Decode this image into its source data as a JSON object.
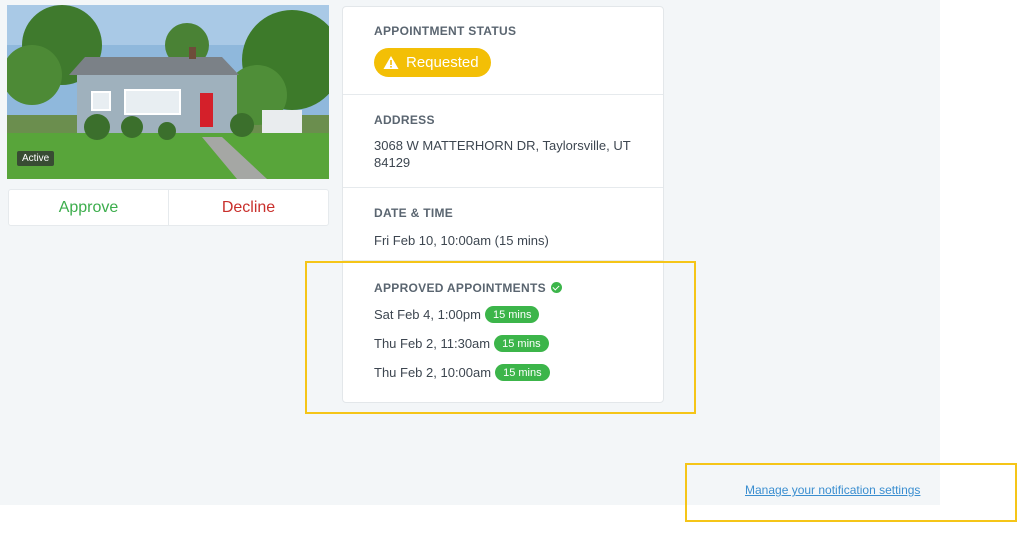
{
  "listing": {
    "status_tag": "Active",
    "approve_label": "Approve",
    "decline_label": "Decline"
  },
  "appointment_status": {
    "label": "APPOINTMENT STATUS",
    "value": "Requested",
    "icon": "warning-triangle-icon",
    "color": "#f3bf06"
  },
  "address": {
    "label": "ADDRESS",
    "line1": "3068 W MATTERHORN DR, Taylorsville, UT",
    "line2": "84129"
  },
  "date_time": {
    "label": "DATE & TIME",
    "value": "Fri Feb 10, 10:00am (15 mins)"
  },
  "approved": {
    "label": "APPROVED APPOINTMENTS",
    "icon": "check-circle-icon",
    "items": [
      {
        "when": "Sat Feb 4, 1:00pm",
        "duration": "15 mins"
      },
      {
        "when": "Thu Feb 2, 11:30am",
        "duration": "15 mins"
      },
      {
        "when": "Thu Feb 2, 10:00am",
        "duration": "15 mins"
      }
    ]
  },
  "footer": {
    "notification_link": "Manage your notification settings"
  },
  "colors": {
    "approve": "#3cad4c",
    "decline": "#c9302c",
    "badge": "#3cb54a",
    "highlight": "#f5c518",
    "link": "#3a8ed0"
  }
}
